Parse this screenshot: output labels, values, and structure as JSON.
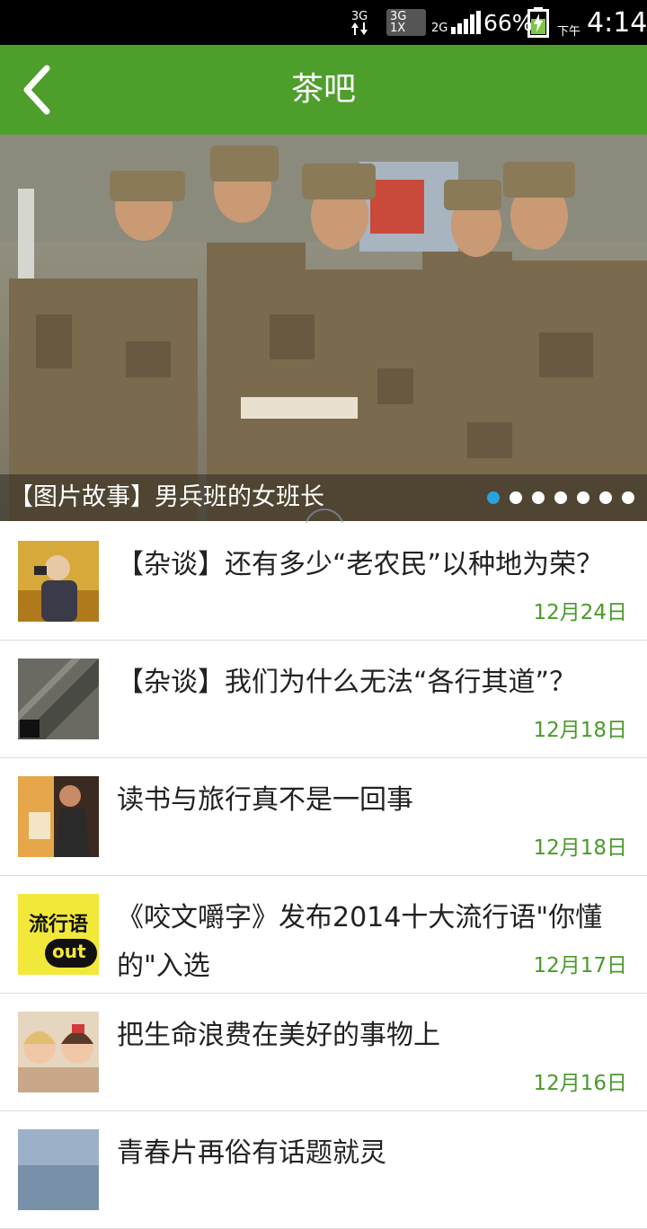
{
  "status_bar": {
    "net_3g": "3G",
    "sim_3g": "3G",
    "sim_1x": "1X",
    "net_2g": "2G",
    "battery": "66%",
    "ampm": "下午",
    "time": "4:14"
  },
  "app_bar": {
    "title": "茶吧",
    "back_icon": "chevron-left-icon"
  },
  "banner": {
    "caption": "【图片故事】男兵班的女班长",
    "dot_count": 7,
    "active_dot": 1
  },
  "articles": [
    {
      "title": "【杂谈】还有多少“老农民”以种地为荣？",
      "date": "12月24日"
    },
    {
      "title": "【杂谈】我们为什么无法“各行其道”？",
      "date": "12月18日"
    },
    {
      "title": "读书与旅行真不是一回事",
      "date": "12月18日"
    },
    {
      "title": "《咬文嚼字》发布2014十大流行语\"你懂的\"入选",
      "date": "12月17日"
    },
    {
      "title": "把生命浪费在美好的事物上",
      "date": "12月16日"
    },
    {
      "title": "青春片再俗有话题就灵",
      "date": ""
    }
  ],
  "thumb_texts": {
    "buzzword": "流行语",
    "out": "out"
  },
  "colors": {
    "accent": "#4e9e2c",
    "date": "#4a9a2a",
    "active_dot": "#29a3e0"
  }
}
